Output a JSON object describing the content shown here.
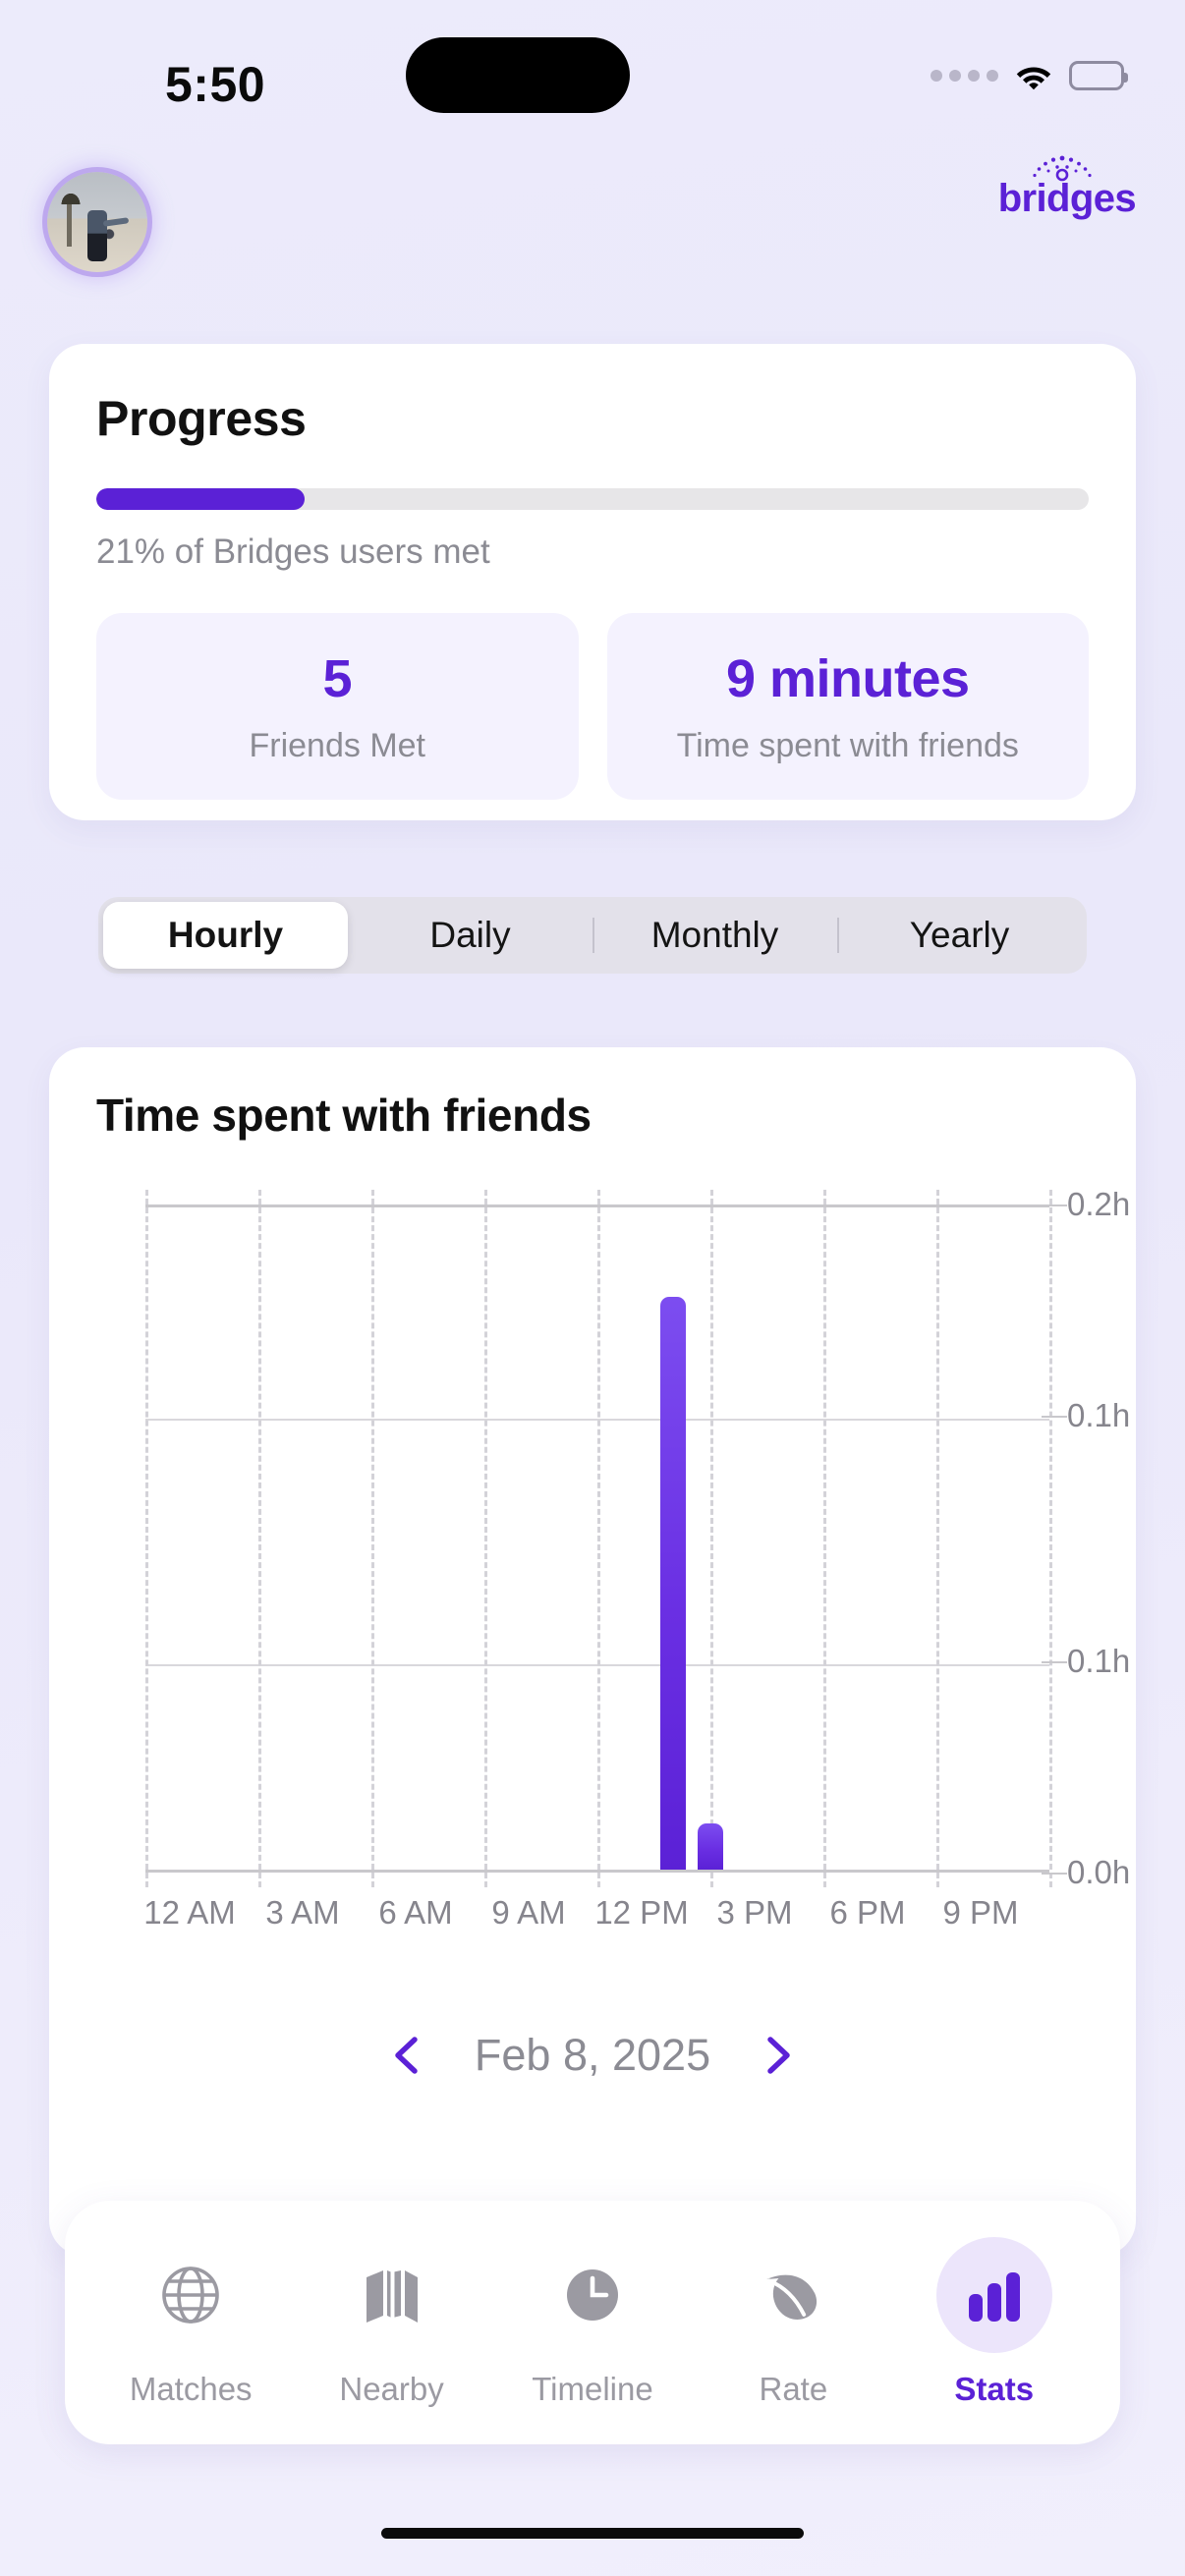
{
  "status_bar": {
    "time": "5:50",
    "icons": [
      "cellular-dots-icon",
      "wifi-icon",
      "battery-icon"
    ]
  },
  "header": {
    "avatar_name": "user-avatar",
    "logo_text": "bridges"
  },
  "progress_card": {
    "title": "Progress",
    "progress_percent": 21,
    "progress_caption": "21% of Bridges users met",
    "stats": [
      {
        "value": "5",
        "label": "Friends Met"
      },
      {
        "value": "9 minutes",
        "label": "Time spent with friends"
      }
    ]
  },
  "segmented_control": {
    "options": [
      "Hourly",
      "Daily",
      "Monthly",
      "Yearly"
    ],
    "selected": "Hourly"
  },
  "chart_card": {
    "title": "Time spent with friends",
    "date_nav": {
      "prev_icon": "chevron-left-icon",
      "date": "Feb 8, 2025",
      "next_icon": "chevron-right-icon"
    }
  },
  "chart_data": {
    "type": "bar",
    "title": "Time spent with friends",
    "xlabel": "",
    "ylabel": "",
    "unit": "h",
    "x_tick_labels": [
      "12 AM",
      "3 AM",
      "6 AM",
      "9 AM",
      "12 PM",
      "3 PM",
      "6 PM",
      "9 PM"
    ],
    "x_tick_hours": [
      0,
      3,
      6,
      9,
      12,
      15,
      18,
      21
    ],
    "y_tick_labels": [
      "0.2h",
      "0.1h",
      "0.1h",
      "0.0h"
    ],
    "y_tick_values": [
      0.19,
      0.13,
      0.06,
      0.0
    ],
    "ylim": [
      0,
      0.19
    ],
    "xlim": [
      0,
      24
    ],
    "grid": true,
    "legend": false,
    "bar_color": "#5b21d6",
    "categories": [
      "2 PM",
      "3 PM"
    ],
    "values": [
      0.163,
      0.013
    ],
    "bars": [
      {
        "hour": 14,
        "value": 0.163
      },
      {
        "hour": 15,
        "value": 0.013
      }
    ]
  },
  "tabbar": {
    "tabs": [
      {
        "label": "Matches",
        "icon": "globe-icon",
        "active": false
      },
      {
        "label": "Nearby",
        "icon": "map-icon",
        "active": false
      },
      {
        "label": "Timeline",
        "icon": "clock-icon",
        "active": false
      },
      {
        "label": "Rate",
        "icon": "leaf-icon",
        "active": false
      },
      {
        "label": "Stats",
        "icon": "bar-chart-icon",
        "active": true
      }
    ]
  },
  "colors": {
    "accent": "#5b21d6",
    "muted_text": "#8b8b93",
    "background": "#ecebfb",
    "card": "#ffffff",
    "stat_box": "#f4f2fe"
  }
}
